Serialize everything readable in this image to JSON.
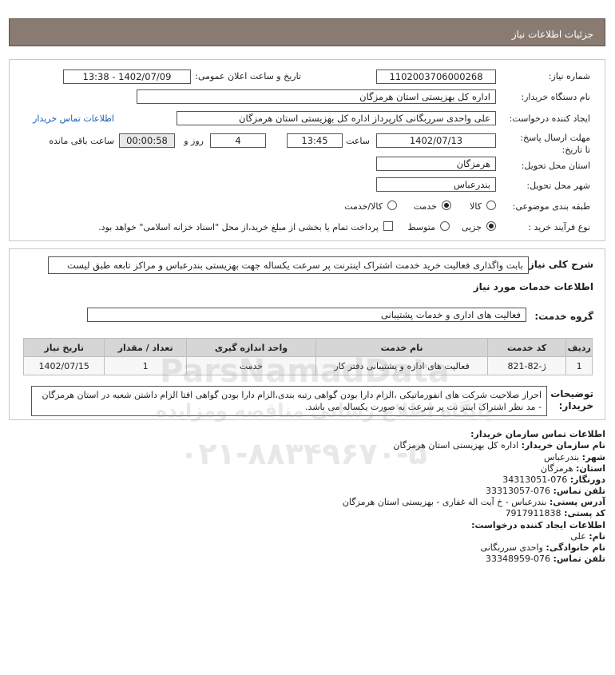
{
  "header": {
    "title": "جزئیات اطلاعات نیاز"
  },
  "form": {
    "need_number_label": "شماره نیاز:",
    "need_number": "1102003706000268",
    "announce_label": "تاریخ و ساعت اعلان عمومی:",
    "announce_value": "1402/07/09 - 13:38",
    "buyer_label": "نام دستگاه خریدار:",
    "buyer_value": "اداره کل بهزیستی استان هرمزگان",
    "creator_label": "ایجاد کننده درخواست:",
    "creator_value": "علی  واحدی سرربگانی کارپرداز اداره کل بهزیستی استان هرمزگان",
    "contact_link": "اطلاعات تماس خریدار",
    "deadline_label": "مهلت ارسال پاسخ: تا تاریخ:",
    "deadline_date": "1402/07/13",
    "time_label": "ساعت",
    "deadline_time": "13:45",
    "days_value": "4",
    "days_label": "روز و",
    "remaining_value": "00:00:58",
    "remaining_label": "ساعت باقی مانده",
    "province_label": "استان محل تحویل:",
    "province_value": "هرمزگان",
    "city_label": "شهر محل تحویل:",
    "city_value": "بندرعباس",
    "category_label": "طبقه بندی موضوعی:",
    "category_options": [
      "کالا",
      "خدمت",
      "کالا/خدمت"
    ],
    "category_selected": "خدمت",
    "process_label": "نوع فرآیند خرید :",
    "process_options": [
      "جزیی",
      "متوسط"
    ],
    "process_selected": "جزیی",
    "payment_text": "پرداخت تمام یا بخشی از مبلغ خرید،از محل \"اسناد خزانه اسلامی\" خواهد بود."
  },
  "description": {
    "label": "شرح کلی نیاز:",
    "value": "بابت واگذاری فعالیت خرید خدمت اشتراک اینترنت پر سرعت یکساله جهت بهزیستی بندرعباس و مراکز تابعه طبق لیست",
    "services_heading": "اطلاعات خدمات مورد نیاز",
    "service_group_label": "گروه خدمت:",
    "service_group_value": "فعالیت های اداری و خدمات پشتیبانی"
  },
  "table": {
    "headers": [
      "ردیف",
      "کد خدمت",
      "نام خدمت",
      "واحد اندازه گیری",
      "تعداد / مقدار",
      "تاریخ نیاز"
    ],
    "rows": [
      [
        "1",
        "ژ-82-821",
        "فعالیت های اداره و پشتیبانی دفتر کار",
        "خدمت",
        "1",
        "1402/07/15"
      ]
    ]
  },
  "buyer_notes": {
    "label": "توضیحات خریدار:",
    "value": "احراز صلاحیت شرکت های انفورماتیکی ،الزام دارا بودن گواهی رتبه بندی،الزام دارا بودن گواهی افتا الزام داشتن شعبه در استان هرمزگان - مد نظر اشتراک اینتر نت پر سرعت به صورت یکساله می باشد."
  },
  "contact": {
    "org_heading": "اطلاعات تماس سازمان خریدار:",
    "org_name_label": "نام سازمان خریدار:",
    "org_name": "اداره کل بهزیستی استان هرمزگان",
    "city_label": "شهر:",
    "city": "بندرعباس",
    "province_label": "استان:",
    "province": "هرمزگان",
    "fax_label": "دورنگار:",
    "fax": "076-34313051",
    "phone_label": "تلفن تماس:",
    "phone": "076-33313057",
    "address_label": "آدرس پستی:",
    "address": "بندرعباس - خ آیت اله غفاری - بهزیستی استان هرمزگان",
    "postal_label": "کد پستی:",
    "postal": "7917911838",
    "creator_heading": "اطلاعات ایجاد کننده درخواست:",
    "first_name_label": "نام:",
    "first_name": "علی",
    "last_name_label": "نام خانوادگی:",
    "last_name": "واحدی سرربگانی",
    "creator_phone_label": "تلفن تماس:",
    "creator_phone": "076-33348959"
  },
  "watermark": {
    "brand": "ParsNamadData",
    "tagline": "پایگاه اطلاع رسانی مناقصه ومزایده",
    "phone": "۰۲۱-۸۸۳۴۹۶۷۰-۵"
  }
}
